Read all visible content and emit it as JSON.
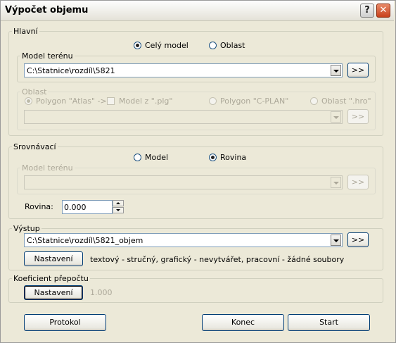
{
  "window": {
    "title": "Výpočet objemu",
    "help_label": "?",
    "close_label": "✕"
  },
  "hlavni": {
    "legend": "Hlavní",
    "mode_options": [
      {
        "label": "Celý model",
        "selected": true
      },
      {
        "label": "Oblast",
        "selected": false
      }
    ],
    "model_terenu": {
      "legend": "Model terénu",
      "value": "C:\\Statnice\\rozdíl\\5821",
      "browse_label": ">>"
    },
    "oblast": {
      "legend": "Oblast",
      "options": [
        {
          "label": "Polygon \"Atlas\" ->",
          "kind": "radio",
          "selected": true
        },
        {
          "label": "Model z \".plg\"",
          "kind": "checkbox",
          "selected": false
        },
        {
          "label": "Polygon \"C-PLAN\"",
          "kind": "radio",
          "selected": false
        },
        {
          "label": "Oblast \".hro\"",
          "kind": "radio",
          "selected": false
        }
      ],
      "value": "",
      "browse_label": ">>"
    }
  },
  "srovnavaci": {
    "legend": "Srovnávací",
    "mode_options": [
      {
        "label": "Model",
        "selected": false
      },
      {
        "label": "Rovina",
        "selected": true
      }
    ],
    "model_terenu": {
      "legend": "Model terénu",
      "value": "",
      "browse_label": ">>"
    },
    "rovina": {
      "label": "Rovina:",
      "value": "0.000"
    }
  },
  "vystup": {
    "legend": "Výstup",
    "value": "C:\\Statnice\\rozdíl\\5821_objem",
    "browse_label": ">>",
    "settings_label": "Nastavení",
    "summary": "textový - stručný,  grafický - nevytvářet,  pracovní - žádné soubory"
  },
  "koeficient": {
    "legend": "Koeficient přepočtu",
    "settings_label": "Nastavení",
    "value": "1.000"
  },
  "footer": {
    "protokol_label": "Protokol",
    "konec_label": "Konec",
    "start_label": "Start"
  }
}
